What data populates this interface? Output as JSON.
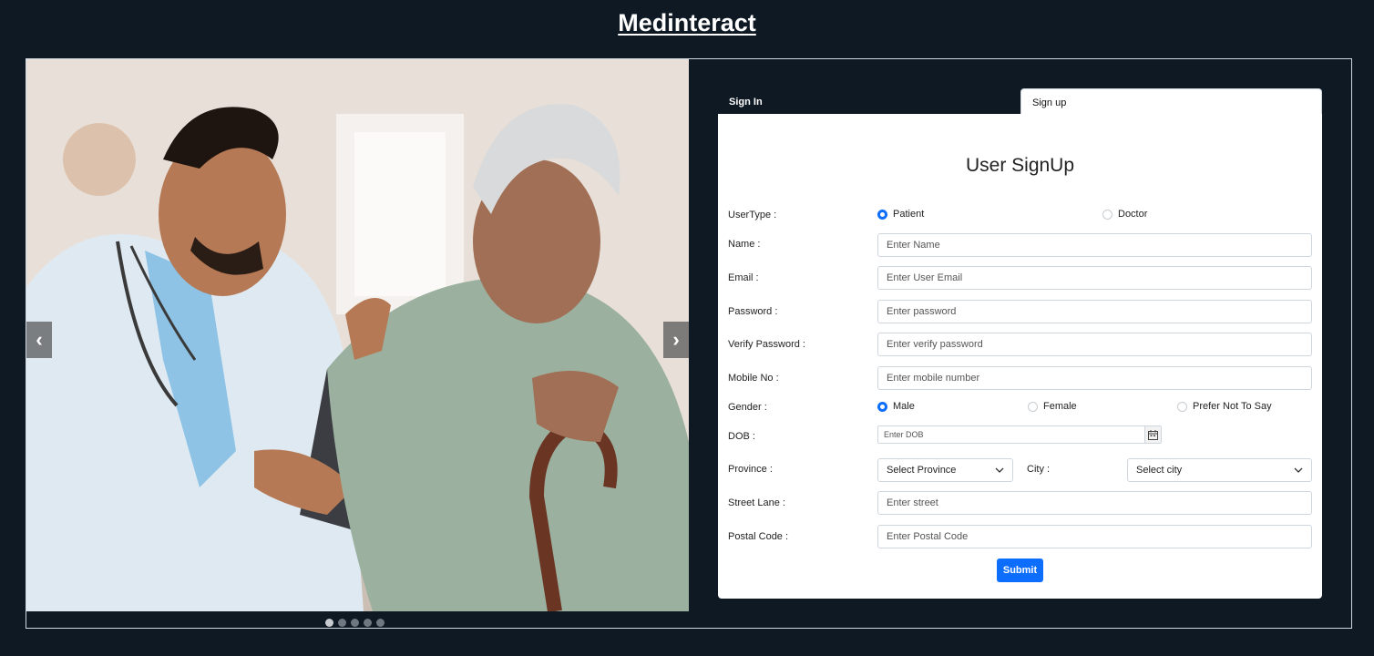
{
  "app": {
    "title": "Medinteract"
  },
  "carousel": {
    "prev_icon": "‹",
    "next_icon": "›",
    "slide_count": 5,
    "active_slide": 1
  },
  "tabs": [
    {
      "label": "Sign In",
      "active": false
    },
    {
      "label": "Sign up",
      "active": true
    }
  ],
  "form": {
    "title": "User SignUp",
    "usertype": {
      "label": "UserType :",
      "options": [
        "Patient",
        "Doctor"
      ],
      "selected": "Patient"
    },
    "name": {
      "label": "Name :",
      "placeholder": "Enter Name"
    },
    "email": {
      "label": "Email :",
      "placeholder": "Enter User Email"
    },
    "password": {
      "label": "Password :",
      "placeholder": "Enter password"
    },
    "verify_password": {
      "label": "Verify Password :",
      "placeholder": "Enter verify password"
    },
    "mobile": {
      "label": "Mobile No :",
      "placeholder": "Enter mobile number"
    },
    "gender": {
      "label": "Gender :",
      "options": [
        "Male",
        "Female",
        "Prefer Not To Say"
      ],
      "selected": "Male"
    },
    "dob": {
      "label": "DOB :",
      "placeholder": "Enter DOB"
    },
    "province": {
      "label": "Province :",
      "value": "Select Province"
    },
    "city": {
      "label": "City :",
      "value": "Select city"
    },
    "street": {
      "label": "Street Lane :",
      "placeholder": "Enter street"
    },
    "postal": {
      "label": "Postal Code :",
      "placeholder": "Enter Postal Code"
    },
    "submit_label": "Submit"
  },
  "colors": {
    "background": "#0f1924",
    "accent": "#0d6efd"
  }
}
